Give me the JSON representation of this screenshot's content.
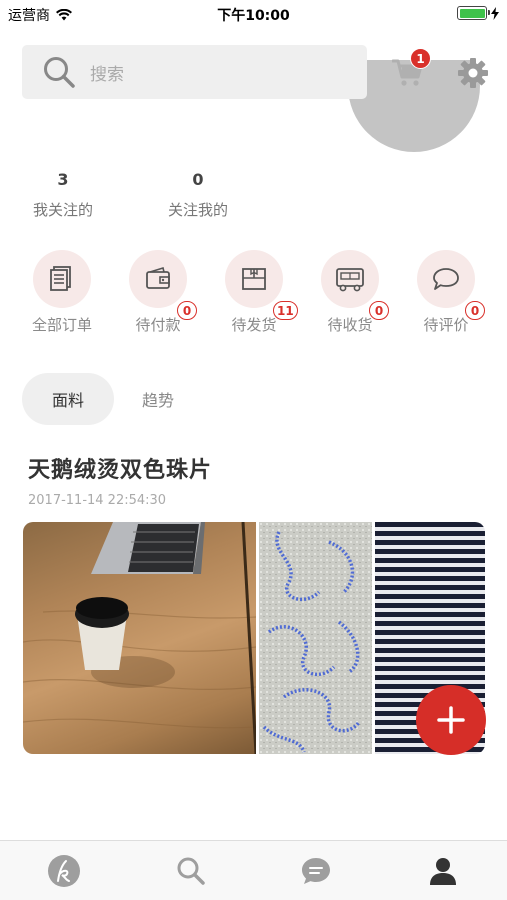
{
  "status_bar": {
    "carrier": "运营商",
    "time": "下午10:00"
  },
  "header": {
    "search": {
      "placeholder": "搜索"
    },
    "cart": {
      "badge_count": "1"
    }
  },
  "stats": [
    {
      "num": "3",
      "label": "我关注的"
    },
    {
      "num": "0",
      "label": "关注我的"
    }
  ],
  "orders": [
    {
      "label": "全部订单",
      "icon": "orders-icon",
      "badge": ""
    },
    {
      "label": "待付款",
      "icon": "wallet-icon",
      "badge": "0"
    },
    {
      "label": "待发货",
      "icon": "package-icon",
      "badge": "11"
    },
    {
      "label": "待收货",
      "icon": "truck-icon",
      "badge": "0"
    },
    {
      "label": "待评价",
      "icon": "comment-icon",
      "badge": "0"
    }
  ],
  "tabs": [
    {
      "label": "面料",
      "active": true
    },
    {
      "label": "趋势",
      "active": false
    }
  ],
  "post": {
    "title": "天鹅绒烫双色珠片",
    "date": "2017-11-14 22:54:30"
  },
  "colors": {
    "accent": "#d62e28",
    "badge_bg": "#d9302a",
    "icon_circle": "#f7e9e8"
  },
  "bottom_nav": [
    "home-logo-icon",
    "search-icon",
    "message-icon",
    "profile-icon"
  ]
}
